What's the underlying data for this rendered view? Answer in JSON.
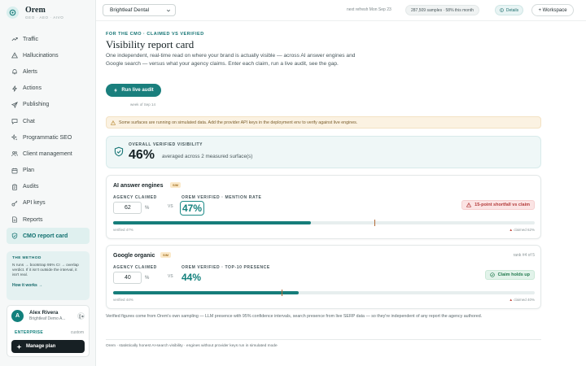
{
  "app": {
    "name": "Orem",
    "subtitle": "GEO · AEO · AIVO"
  },
  "nav": [
    {
      "label": "Traffic",
      "icon": "trending-up-icon"
    },
    {
      "label": "Hallucinations",
      "icon": "warning-triangle-icon"
    },
    {
      "label": "Alerts",
      "icon": "bell-icon"
    },
    {
      "label": "Actions",
      "icon": "lightning-icon"
    },
    {
      "label": "Publishing",
      "icon": "send-icon"
    },
    {
      "label": "Chat",
      "icon": "chat-bubble-icon"
    },
    {
      "label": "Programmatic SEO",
      "icon": "sparkles-icon"
    },
    {
      "label": "Client management",
      "icon": "users-icon"
    },
    {
      "label": "Plan",
      "icon": "calendar-icon"
    },
    {
      "label": "Audits",
      "icon": "clipboard-icon"
    },
    {
      "label": "API keys",
      "icon": "key-icon"
    },
    {
      "label": "Reports",
      "icon": "document-icon"
    },
    {
      "label": "CMO report card",
      "icon": "shield-icon",
      "active": true
    }
  ],
  "method": {
    "title": "THE METHOD",
    "body": "N runs → bootstrap 95% CI → overlap verdict. If it isn't outside the interval, it isn't real.",
    "link": "How it works →"
  },
  "user": {
    "initial": "A",
    "name": "Alex Rivera",
    "org": "Brightleaf Demo A...",
    "plan": "ENTERPRISE",
    "plan_type": "custom",
    "manage_label": "Manage plan"
  },
  "topbar": {
    "org_select": "Brightleaf Dental",
    "refresh": "next refresh Mon Sep 23",
    "samples": "287,509 samples · 58% this month",
    "details_label": "Details",
    "workspace_label": "+ Workspace"
  },
  "page": {
    "eyebrow": "FOR THE CMO · CLAIMED VS VERIFIED",
    "title": "Visibility report card",
    "intro": "One independent, real-time read on where your brand is actually visible — across AI answer engines and Google search — versus what your agency claims. Enter each claim, run a live audit, see the gap.",
    "audit_button": "Run live audit",
    "week": "week of Sep 14",
    "banner": "Some surfaces are running on simulated data. Add the provider API keys in the deployment env to verify against live engines."
  },
  "overall": {
    "label": "OVERALL VERIFIED VISIBILITY",
    "value": "46%",
    "description": "averaged across 2 measured surface(s)"
  },
  "cards": [
    {
      "title": "AI answer engines",
      "badge": "SIM",
      "rank": "",
      "claimed_label": "AGENCY CLAIMED",
      "claimed_value": "62",
      "pct_symbol": "%",
      "vs": "VS",
      "verified_label": "OREM VERIFIED · MENTION RATE",
      "verified_value": "47%",
      "verified_fraction": 0.47,
      "claimed_fraction": 0.62,
      "status": "15-point shortfall vs claim",
      "status_kind": "bad",
      "foot_verified": "verified 47%",
      "foot_claimed": "claimed 62%"
    },
    {
      "title": "Google organic",
      "badge": "SIM",
      "rank": "rank #4 of 5",
      "claimed_label": "AGENCY CLAIMED",
      "claimed_value": "40",
      "pct_symbol": "%",
      "vs": "VS",
      "verified_label": "OREM VERIFIED · TOP-10 PRESENCE",
      "verified_value": "44%",
      "verified_fraction": 0.44,
      "claimed_fraction": 0.4,
      "status": "Claim holds up",
      "status_kind": "good",
      "foot_verified": "verified 44%",
      "foot_claimed": "claimed 40%"
    }
  ],
  "note": "Verified figures come from Orem's own sampling — LLM presence with 95% confidence intervals, search presence from live SERP data — so they're independent of any report the agency authored.",
  "footer": "Orem · statistically honest AI-search visibility · engines without provider keys run in simulated mode",
  "colors": {
    "accent": "#167d7a",
    "bad": "#b43b3b",
    "good": "#237b4f",
    "claim_marker": "#b26a37"
  }
}
